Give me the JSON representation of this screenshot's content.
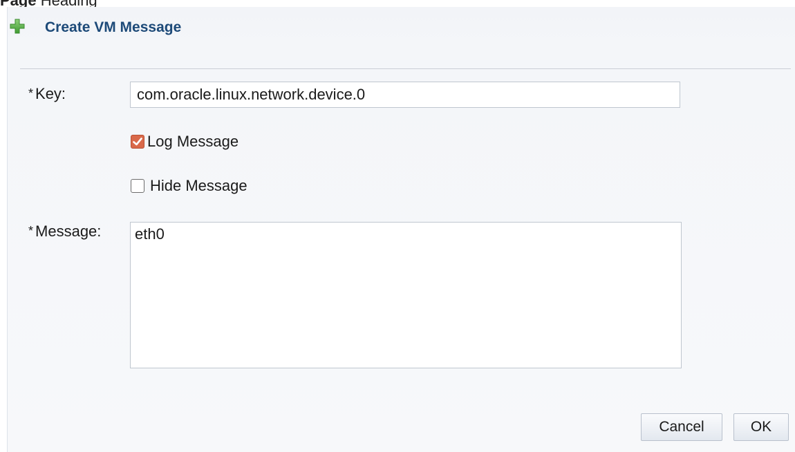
{
  "page": {
    "clipped_caption_bold": "Page",
    "clipped_caption_rest": " Heading"
  },
  "dialog": {
    "title": "Create VM Message",
    "title_icon": "plus-icon",
    "accent_color": "#1d4a78"
  },
  "form": {
    "required_marker": "*",
    "key_label": "Key:",
    "key_value": "com.oracle.linux.network.device.0",
    "log_message": {
      "label": "Log Message",
      "checked": true,
      "color": "#d9694a"
    },
    "hide_message": {
      "label": "Hide Message",
      "checked": false
    },
    "message_label": "Message:",
    "message_value": "eth0"
  },
  "buttons": {
    "cancel": "Cancel",
    "ok": "OK"
  }
}
